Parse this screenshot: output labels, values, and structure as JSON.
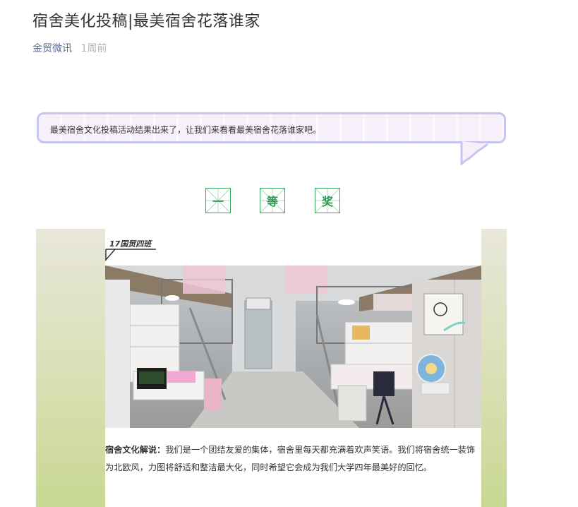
{
  "article": {
    "title": "宿舍美化投稿|最美宿舍花落谁家",
    "author": "金贸微讯",
    "time": "1周前"
  },
  "intro": {
    "text": "最美宿舍文化投稿活动结果出来了，让我们来看看最美宿舍花落谁家吧。"
  },
  "award": {
    "chars": [
      "一",
      "等",
      "奖"
    ]
  },
  "entry": {
    "class_name": "17国贸四班",
    "desc_label": "宿舍文化解说：",
    "desc_text": "我们是一个团结友爱的集体，宿舍里每天都充满着欢声笑语。我们将宿舍统一装饰为北欧风，力图将舒适和整洁最大化，同时希望它会成为我们大学四年最美好的回忆。"
  },
  "colors": {
    "author_link": "#576b95",
    "award_green": "#2e9b53",
    "bubble_border": "#c9c4ef"
  }
}
